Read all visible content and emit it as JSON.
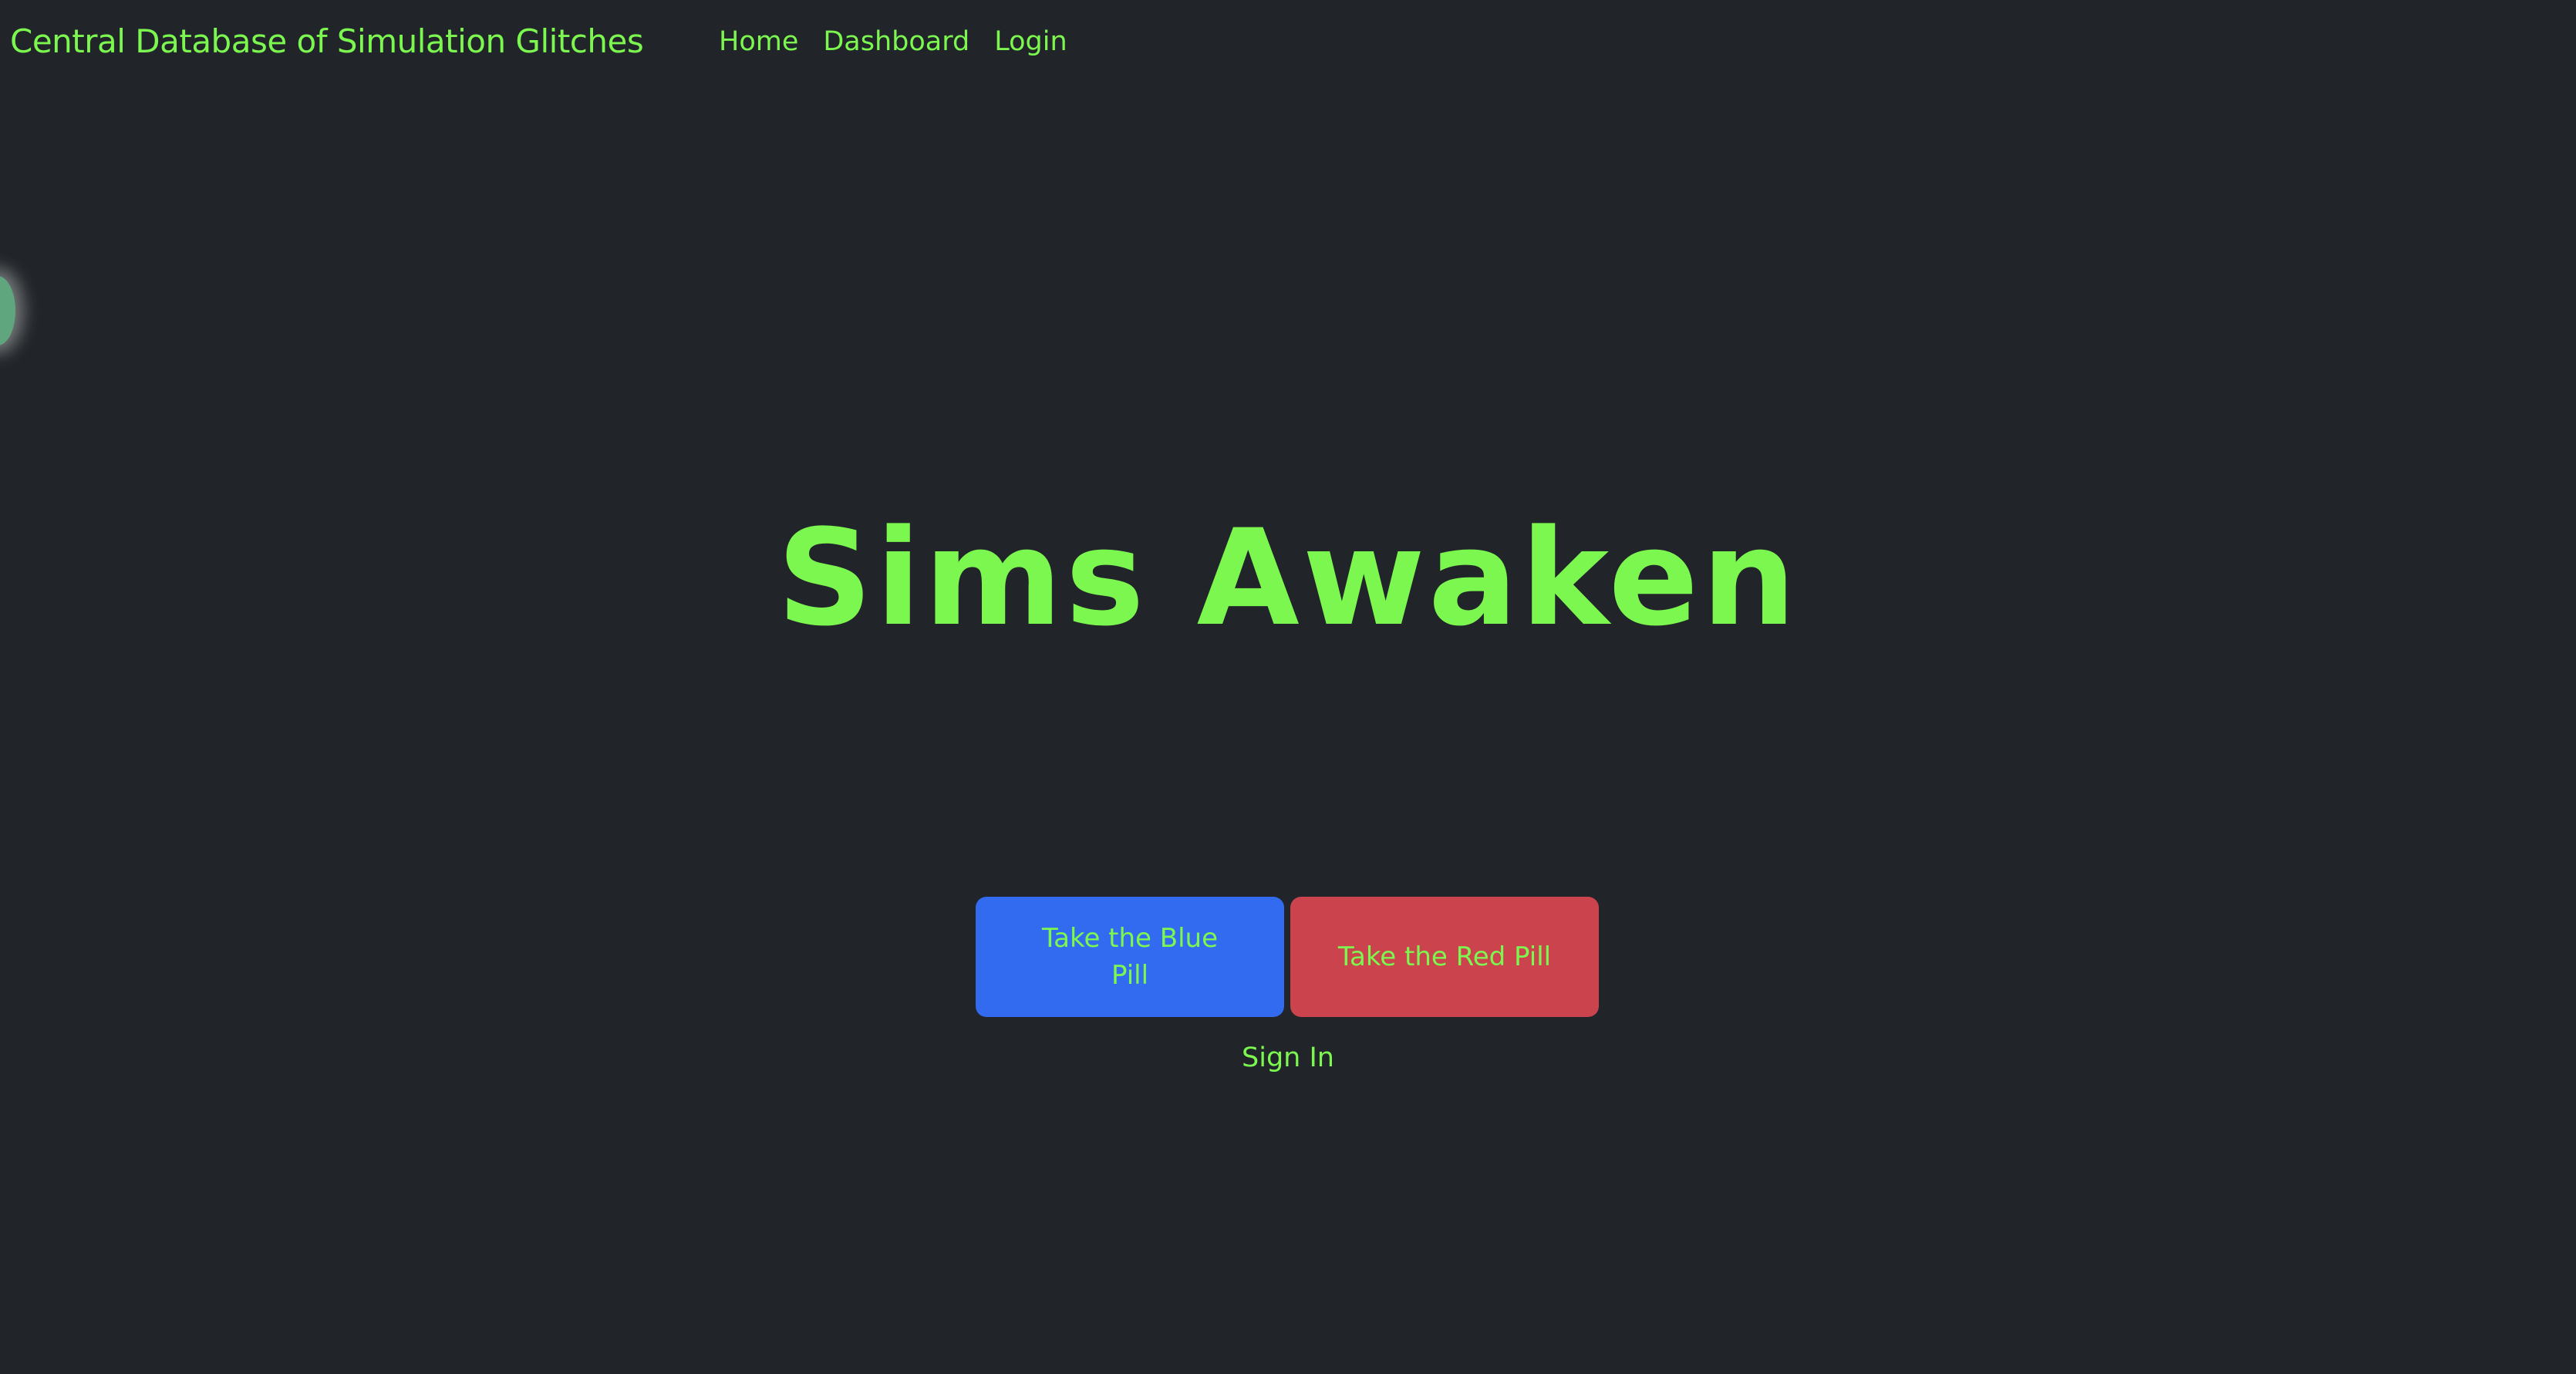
{
  "navbar": {
    "brand": "Central Database of Simulation Glitches",
    "links": [
      {
        "label": "Home"
      },
      {
        "label": "Dashboard"
      },
      {
        "label": "Login"
      }
    ]
  },
  "hero": {
    "title": "Sims Awaken"
  },
  "actions": {
    "blue_pill_label": "Take the Blue Pill",
    "red_pill_label": "Take the Red Pill",
    "sign_in_label": "Sign In"
  },
  "colors": {
    "background": "#212529",
    "text": "#7cf74f",
    "blue_pill": "#336bf0",
    "red_pill": "#cb444d",
    "orb": "#5fa67e"
  }
}
